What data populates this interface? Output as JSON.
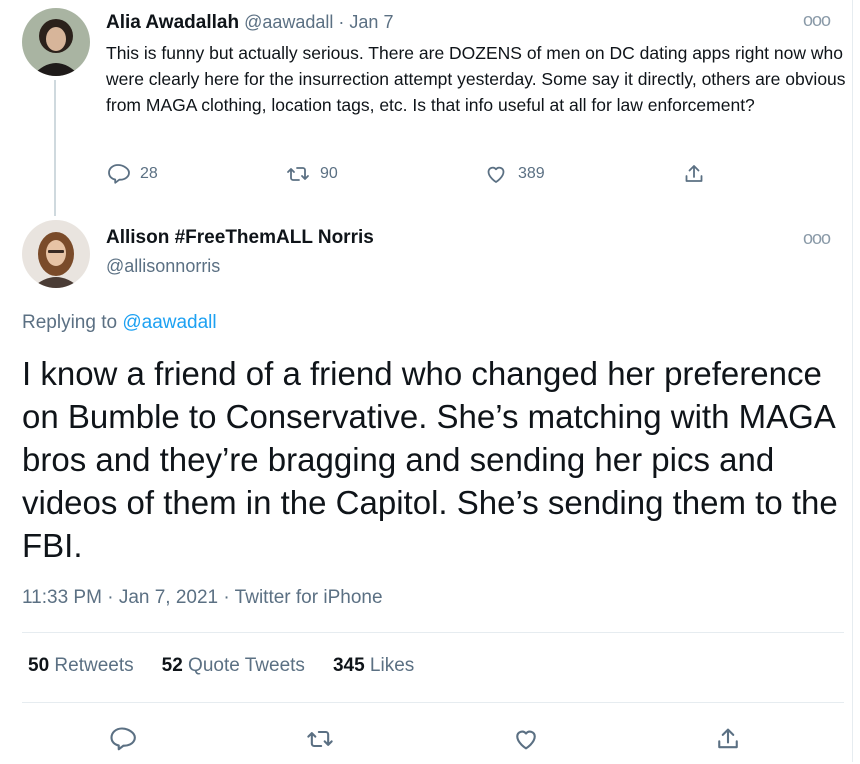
{
  "reply_tweet": {
    "display_name": "Alia Awadallah",
    "handle": "@aawadall",
    "separator": "·",
    "date": "Jan 7",
    "text": "This is funny but actually serious. There are DOZENS of men on DC dating apps right now who were clearly here for the insurrection attempt yesterday. Some say it directly, others are obvious from MAGA clothing, location tags, etc. Is that info useful at all for law enforcement?",
    "replies": "28",
    "retweets": "90",
    "likes": "389"
  },
  "main_tweet": {
    "display_name": "Allison #FreeThemALL Norris",
    "handle": "@allisonnorris",
    "replying_prefix": "Replying to",
    "replying_to": "@aawadall",
    "text": "I know a friend of a friend who changed her preference on Bumble to Conservative. She’s matching with MAGA bros and they’re bragging and sending her pics and videos of them in the Capitol. She’s sending them to the FBI.",
    "time": "11:33 PM",
    "date": "Jan 7, 2021",
    "source": "Twitter for iPhone",
    "retweets_count": "50",
    "retweets_label": "Retweets",
    "quotes_count": "52",
    "quotes_label": "Quote Tweets",
    "likes_count": "345",
    "likes_label": "Likes"
  },
  "more_icon": "more-dots-icon",
  "colors": {
    "link": "#1da1f2",
    "muted": "#5b7083",
    "text": "#0f1419",
    "divider": "#e6ecf0"
  }
}
